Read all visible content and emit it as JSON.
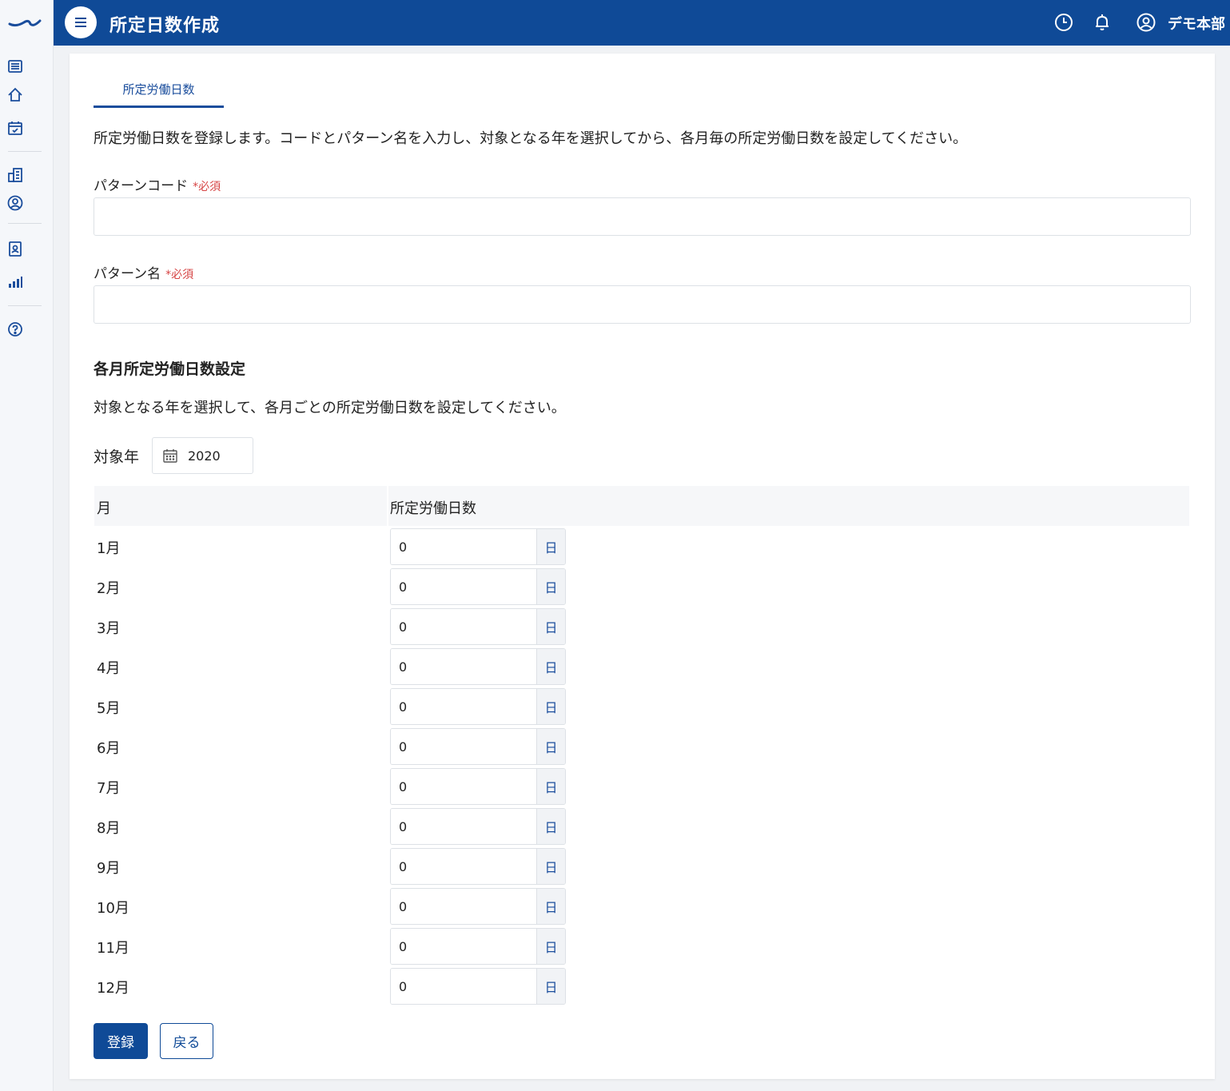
{
  "header": {
    "title": "所定日数作成",
    "user_name": "デモ本部"
  },
  "tabs": [
    {
      "label": "所定労働日数"
    }
  ],
  "intro_text": "所定労働日数を登録します。コードとパターン名を入力し、対象となる年を選択してから、各月毎の所定労働日数を設定してください。",
  "form": {
    "required_mark": "*必須",
    "pattern_code": {
      "label": "パターンコード",
      "value": ""
    },
    "pattern_name": {
      "label": "パターン名",
      "value": ""
    }
  },
  "monthly": {
    "title": "各月所定労働日数設定",
    "description": "対象となる年を選択して、各月ごとの所定労働日数を設定してください。",
    "year_label": "対象年",
    "year_value": "2020",
    "columns": [
      "月",
      "所定労働日数"
    ],
    "unit": "日",
    "rows": [
      {
        "month": "1月",
        "days": "0"
      },
      {
        "month": "2月",
        "days": "0"
      },
      {
        "month": "3月",
        "days": "0"
      },
      {
        "month": "4月",
        "days": "0"
      },
      {
        "month": "5月",
        "days": "0"
      },
      {
        "month": "6月",
        "days": "0"
      },
      {
        "month": "7月",
        "days": "0"
      },
      {
        "month": "8月",
        "days": "0"
      },
      {
        "month": "9月",
        "days": "0"
      },
      {
        "month": "10月",
        "days": "0"
      },
      {
        "month": "11月",
        "days": "0"
      },
      {
        "month": "12月",
        "days": "0"
      }
    ]
  },
  "buttons": {
    "submit": "登録",
    "back": "戻る"
  },
  "icons": {
    "sidebar": [
      "list-icon",
      "home-icon",
      "calendar-check-icon",
      "building-icon",
      "user-circle-icon",
      "id-badge-icon",
      "bar-chart-icon",
      "help-icon"
    ],
    "topbar": [
      "menu-icon",
      "clock-icon",
      "bell-icon",
      "account-icon"
    ]
  },
  "colors": {
    "primary": "#0f4a97",
    "required": "#d64545",
    "background": "#f0f2f5"
  }
}
